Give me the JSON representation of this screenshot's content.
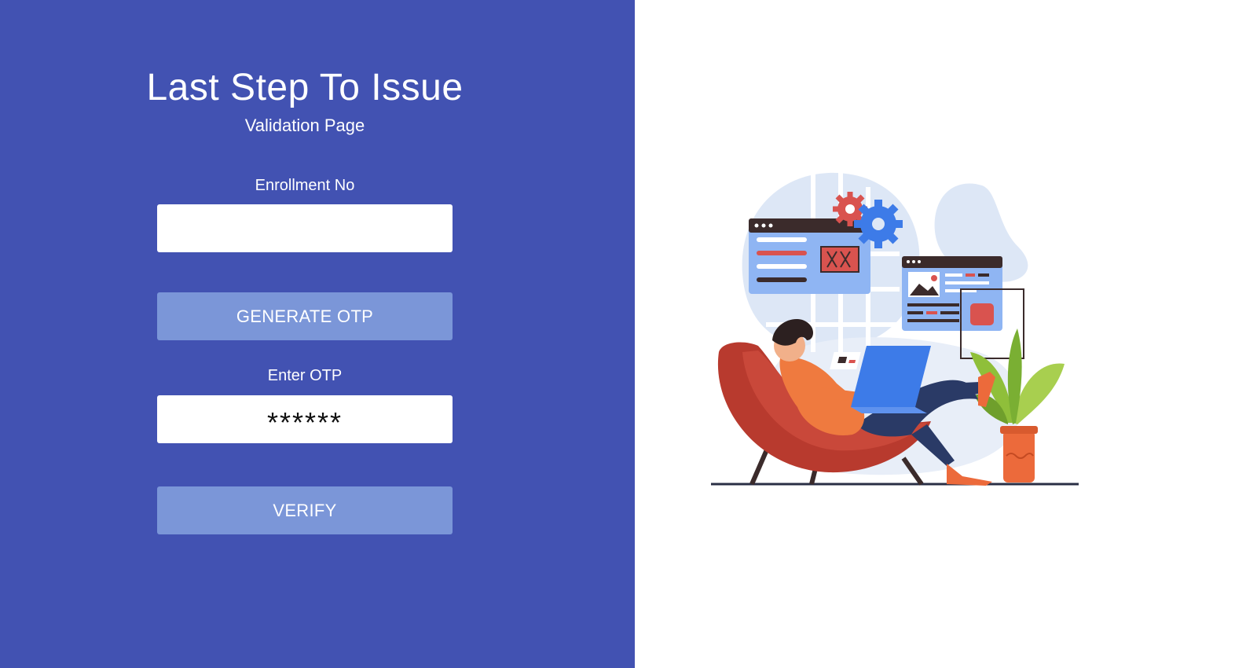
{
  "form": {
    "title": "Last Step To Issue",
    "subtitle": "Validation Page",
    "enrollment_label": "Enrollment No",
    "enrollment_value": "",
    "generate_button": "GENERATE OTP",
    "otp_label": "Enter OTP",
    "otp_value": "******",
    "verify_button": "VERIFY"
  },
  "illustration": {
    "icon": "person-with-laptop-illustration"
  },
  "colors": {
    "panel": "#4252b2",
    "button": "#7b96d8",
    "background": "#ffffff"
  }
}
